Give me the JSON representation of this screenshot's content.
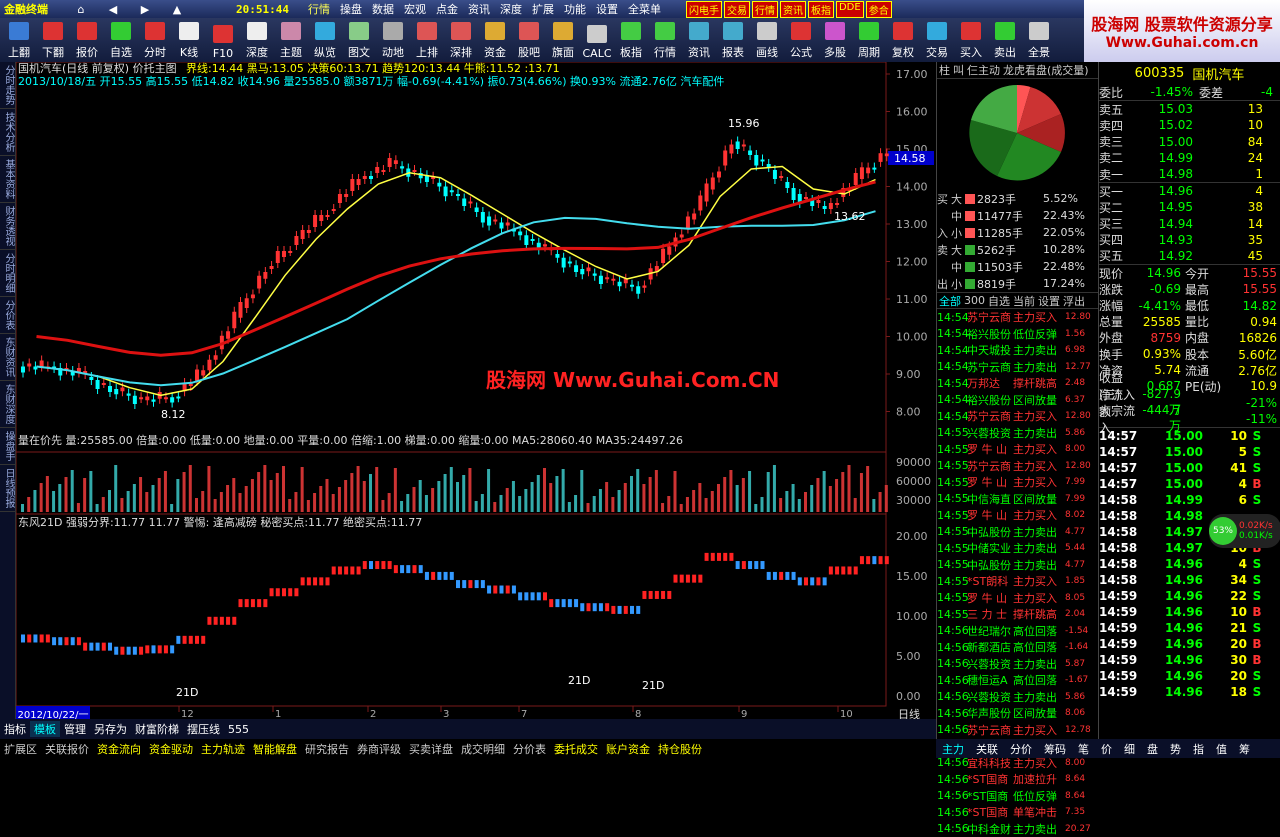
{
  "app": {
    "brand": "金融终端",
    "clock": "20:51:44",
    "menus": [
      "行情",
      "操盘",
      "数据",
      "宏观",
      "点金",
      "资讯",
      "深度",
      "扩展",
      "功能",
      "设置",
      "全菜单"
    ],
    "tags": [
      "闪电手",
      "交易",
      "行情",
      "资讯",
      "板指",
      "DDE",
      "参合"
    ]
  },
  "toolbar": [
    "上翻",
    "下翻",
    "报价",
    "自选",
    "分时",
    "K线",
    "F10",
    "深度",
    "主题",
    "纵览",
    "图文",
    "动地",
    "上排",
    "深排",
    "资金",
    "股吧",
    "旗面",
    "CALC",
    "板指",
    "行情",
    "资讯",
    "报表",
    "画线",
    "公式",
    "多股",
    "周期",
    "复权",
    "交易",
    "买入",
    "卖出",
    "全景"
  ],
  "logo": {
    "l1": "股海网 股票软件资源分享",
    "l2": "Www.Guhai.com.cn"
  },
  "leftnav": [
    "分时走势",
    "技术分析",
    "基本资料",
    "财务透视",
    "分时明细",
    "分价表",
    "东财资讯",
    "东财深度",
    "操盘手",
    "日线预报"
  ],
  "main": {
    "title": "国机汽车(日线 前复权) 价托主图",
    "line1": "界线:14.44 黑马:13.05 决策60:13.71 趋势120:13.44 牛熊:11.52 :13.71",
    "line2": "2013/10/18/五 开15.55 高15.55 低14.82 收14.96 量25585.0 额3871万 幅-0.69(-4.41%) 振0.73(4.66%) 换0.93% 流通2.76亿 汽车配件",
    "vol": "量在价先 量:25585.00 倍量:0.00 低量:0.00 地量:0.00 平量:0.00 倍缩:1.00 梯量:0.00 缩量:0.00 MA5:28060.40 MA35:24497.26",
    "sub": "东风21D 强弱分界:11.77 11.77    警惕:  逢高减磅  秘密买点:11.77 绝密买点:11.77",
    "watermark": "股海网 Www.Guhai.Com.CN",
    "yaxis": [
      "17.00",
      "16.00",
      "15.00",
      "14.00",
      "13.00",
      "12.00",
      "11.00",
      "10.00",
      "9.00",
      "8.00"
    ],
    "price_now": "14.58",
    "vol_axis": [
      "90000",
      "60000",
      "30000"
    ],
    "sub_axis": [
      "20.00",
      "15.00",
      "10.00",
      "5.00",
      "0.00"
    ],
    "x_labels": [
      "12",
      "1",
      "2",
      "3",
      "7",
      "8",
      "9",
      "10"
    ],
    "annotations": {
      "high": "15.96",
      "low": "8.12",
      "mid": "13.62",
      "d21a": "21D",
      "d21b": "21D",
      "d21c": "21D"
    },
    "date_label": "2012/10/22/一",
    "cycle": "日线"
  },
  "chart_data": {
    "type": "line",
    "title": "国机汽车(日线 前复权)",
    "x_ticks": [
      "12",
      "1",
      "2",
      "3",
      "7",
      "8",
      "9",
      "10"
    ],
    "ylim": [
      8,
      17
    ],
    "series": [
      {
        "name": "收",
        "values": [
          9.2,
          9.0,
          8.6,
          8.3,
          8.4,
          9.1,
          10.5,
          11.8,
          12.6,
          13.4,
          14.2,
          14.6,
          14.3,
          13.8,
          13.2,
          12.8,
          12.3,
          11.8,
          11.5,
          11.3,
          12.4,
          13.6,
          15.2,
          14.6,
          13.8,
          13.4,
          14.2,
          14.96
        ]
      }
    ]
  },
  "tabs1": [
    "指标",
    "模板",
    "管理",
    "另存为",
    "财富阶梯",
    "摆压线",
    "555"
  ],
  "tabs2": [
    "扩展区",
    "关联报价",
    "资金流向",
    "资金驱动",
    "主力轨迹",
    "智能解盘",
    "研究报告",
    "券商评级",
    "买卖详盘",
    "成交明细",
    "分价表",
    "委托成交",
    "账户资金",
    "持仓股份"
  ],
  "mid": {
    "tabs": [
      "柱",
      "叫",
      "仨主动",
      "龙虎看盘(成交量)"
    ],
    "flow": [
      {
        "side": "买",
        "lvl": "大",
        "vol": "2823手",
        "pct": "5.52%"
      },
      {
        "side": "",
        "lvl": "中",
        "vol": "11477手",
        "pct": "22.43%"
      },
      {
        "side": "入",
        "lvl": "小",
        "vol": "11285手",
        "pct": "22.05%"
      },
      {
        "side": "卖",
        "lvl": "大",
        "vol": "5262手",
        "pct": "10.28%"
      },
      {
        "side": "",
        "lvl": "中",
        "vol": "11503手",
        "pct": "22.48%"
      },
      {
        "side": "出",
        "lvl": "小",
        "vol": "8819手",
        "pct": "17.24%"
      }
    ],
    "listtabs": [
      "全部",
      "300",
      "自选",
      "当前",
      "设置",
      "浮出"
    ],
    "orders": [
      [
        "14:54",
        "苏宁云商",
        "主力买入",
        "12.80"
      ],
      [
        "14:54",
        "裕兴股份",
        "低位反弹",
        "1.56"
      ],
      [
        "14:54",
        "中天城投",
        "主力卖出",
        "6.98"
      ],
      [
        "14:54",
        "苏宁云商",
        "主力卖出",
        "12.77"
      ],
      [
        "14:54",
        "万邦达",
        "撑杆跳高",
        "2.48"
      ],
      [
        "14:54",
        "裕兴股份",
        "区间放量",
        "6.37"
      ],
      [
        "14:54",
        "苏宁云商",
        "主力买入",
        "12.80"
      ],
      [
        "14:55",
        "兴蓉投资",
        "主力卖出",
        "5.86"
      ],
      [
        "14:55",
        "罗 牛 山",
        "主力买入",
        "8.00"
      ],
      [
        "14:55",
        "苏宁云商",
        "主力买入",
        "12.80"
      ],
      [
        "14:55",
        "罗 牛 山",
        "主力买入",
        "7.99"
      ],
      [
        "14:55",
        "中信海直",
        "区间放量",
        "7.99"
      ],
      [
        "14:55",
        "罗 牛 山",
        "主力买入",
        "8.02"
      ],
      [
        "14:55",
        "中弘股份",
        "主力卖出",
        "4.77"
      ],
      [
        "14:55",
        "中储实业",
        "主力卖出",
        "5.44"
      ],
      [
        "14:55",
        "中弘股份",
        "主力卖出",
        "4.77"
      ],
      [
        "14:55",
        "*ST朗科",
        "主力买入",
        "1.85"
      ],
      [
        "14:55",
        "罗 牛 山",
        "主力买入",
        "8.05"
      ],
      [
        "14:55",
        "三 力 士",
        "撑杆跳高",
        "2.04"
      ],
      [
        "14:56",
        "世纪瑞尔",
        "高位回落",
        "-1.54"
      ],
      [
        "14:56",
        "新都酒店",
        "高位回落",
        "-1.64"
      ],
      [
        "14:56",
        "兴蓉投资",
        "主力卖出",
        "5.87"
      ],
      [
        "14:56",
        "穗恒运A",
        "高位回落",
        "-1.67"
      ],
      [
        "14:56",
        "兴蓉投资",
        "主力卖出",
        "5.86"
      ],
      [
        "14:56",
        "华声股份",
        "区间放量",
        "8.06"
      ],
      [
        "14:56",
        "苏宁云商",
        "主力买入",
        "12.78"
      ],
      [
        "14:56",
        "三 力 士",
        "加速拉升",
        "1.70"
      ],
      [
        "14:56",
        "宜科科技",
        "主力买入",
        "8.00"
      ],
      [
        "14:56",
        "*ST国商",
        "加速拉升",
        "8.64"
      ],
      [
        "14:56",
        "*ST国商",
        "低位反弹",
        "8.64"
      ],
      [
        "14:56",
        "*ST国商",
        "单笔冲击",
        "7.35"
      ],
      [
        "14:56",
        "中科金财",
        "主力卖出",
        "20.27"
      ]
    ]
  },
  "right": {
    "code": "600335",
    "name": "国机汽车",
    "wb": {
      "k1": "委比",
      "v1": "-1.45%",
      "k2": "委差",
      "v2": "-4"
    },
    "asks": [
      [
        "卖五",
        "15.03",
        "13"
      ],
      [
        "卖四",
        "15.02",
        "10"
      ],
      [
        "卖三",
        "15.00",
        "84"
      ],
      [
        "卖二",
        "14.99",
        "24"
      ],
      [
        "卖一",
        "14.98",
        "1"
      ]
    ],
    "bids": [
      [
        "买一",
        "14.96",
        "4"
      ],
      [
        "买二",
        "14.95",
        "38"
      ],
      [
        "买三",
        "14.94",
        "14"
      ],
      [
        "买四",
        "14.93",
        "35"
      ],
      [
        "买五",
        "14.92",
        "45"
      ]
    ],
    "stats": [
      [
        "现价",
        "14.96",
        "今开",
        "15.55"
      ],
      [
        "涨跌",
        "-0.69",
        "最高",
        "15.55"
      ],
      [
        "涨幅",
        "-4.41%",
        "最低",
        "14.82"
      ],
      [
        "总量",
        "25585",
        "量比",
        "0.94"
      ],
      [
        "外盘",
        "8759",
        "内盘",
        "16826"
      ],
      [
        "换手",
        "0.93%",
        "股本",
        "5.60亿"
      ],
      [
        "净资",
        "5.74",
        "流通",
        "2.76亿"
      ],
      [
        "收益(三)",
        "0.687",
        "PE(动)",
        "10.9"
      ],
      [
        "净流入额",
        "-827.9万",
        "",
        "-21%"
      ],
      [
        "大宗流入",
        "-444.7万",
        "",
        "-11%"
      ]
    ],
    "ticks": [
      [
        "14:57",
        "15.00",
        "10",
        "S"
      ],
      [
        "14:57",
        "15.00",
        "5",
        "S"
      ],
      [
        "14:57",
        "15.00",
        "41",
        "S"
      ],
      [
        "14:57",
        "15.00",
        "4",
        "B"
      ],
      [
        "14:58",
        "14.99",
        "6",
        "S"
      ],
      [
        "14:58",
        "14.98",
        "",
        ""
      ],
      [
        "14:58",
        "14.97",
        "35",
        "S"
      ],
      [
        "14:58",
        "14.97",
        "10",
        "B"
      ],
      [
        "14:58",
        "14.96",
        "4",
        "S"
      ],
      [
        "14:58",
        "14.96",
        "34",
        "S"
      ],
      [
        "14:59",
        "14.96",
        "22",
        "S"
      ],
      [
        "14:59",
        "14.96",
        "10",
        "B"
      ],
      [
        "14:59",
        "14.96",
        "21",
        "S"
      ],
      [
        "14:59",
        "14.96",
        "20",
        "B"
      ],
      [
        "14:59",
        "14.96",
        "30",
        "B"
      ],
      [
        "14:59",
        "14.96",
        "20",
        "S"
      ],
      [
        "14:59",
        "14.96",
        "18",
        "S"
      ]
    ],
    "badge": {
      "pct": "53%",
      "up": "0.02K/s",
      "down": "0.01K/s"
    }
  },
  "bottomright": [
    "主力",
    "关联",
    "分价",
    "筹码",
    "笔",
    "价",
    "细",
    "盘",
    "势",
    "指",
    "值",
    "筹"
  ],
  "colors": {
    "up": "#ff3333",
    "down": "#00ff00",
    "ma_yellow": "#ffff44",
    "ma_cyan": "#44ddee",
    "ma_red": "#dd1111"
  }
}
